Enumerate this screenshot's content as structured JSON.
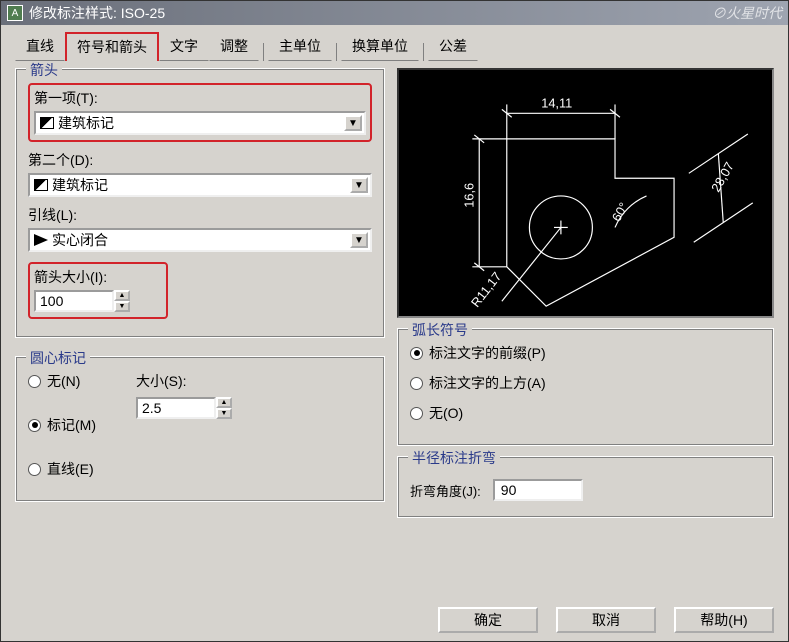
{
  "window": {
    "title": "修改标注样式: ISO-25"
  },
  "tabs": {
    "line": "直线",
    "symbols": "符号和箭头",
    "text": "文字",
    "adjust": "调整",
    "primary": "主单位",
    "alt": "换算单位",
    "tolerance": "公差"
  },
  "arrows": {
    "legend": "箭头",
    "first_label": "第一项(T):",
    "first_value": "建筑标记",
    "second_label": "第二个(D):",
    "second_value": "建筑标记",
    "leader_label": "引线(L):",
    "leader_value": "实心闭合",
    "size_label": "箭头大小(I):",
    "size_value": "100"
  },
  "center_marks": {
    "legend": "圆心标记",
    "none": "无(N)",
    "mark": "标记(M)",
    "line": "直线(E)",
    "size_label": "大小(S):",
    "size_value": "2.5",
    "selected": "mark"
  },
  "arc": {
    "legend": "弧长符号",
    "prefix": "标注文字的前缀(P)",
    "above": "标注文字的上方(A)",
    "none": "无(O)",
    "selected": "prefix"
  },
  "radius": {
    "legend": "半径标注折弯",
    "angle_label": "折弯角度(J):",
    "angle_value": "90"
  },
  "preview": {
    "dims": {
      "top": "14,11",
      "left": "16,6",
      "radius": "R11,17",
      "angle": "60°",
      "diag": "28,07"
    }
  },
  "buttons": {
    "ok": "确定",
    "cancel": "取消",
    "help": "帮助(H)"
  }
}
